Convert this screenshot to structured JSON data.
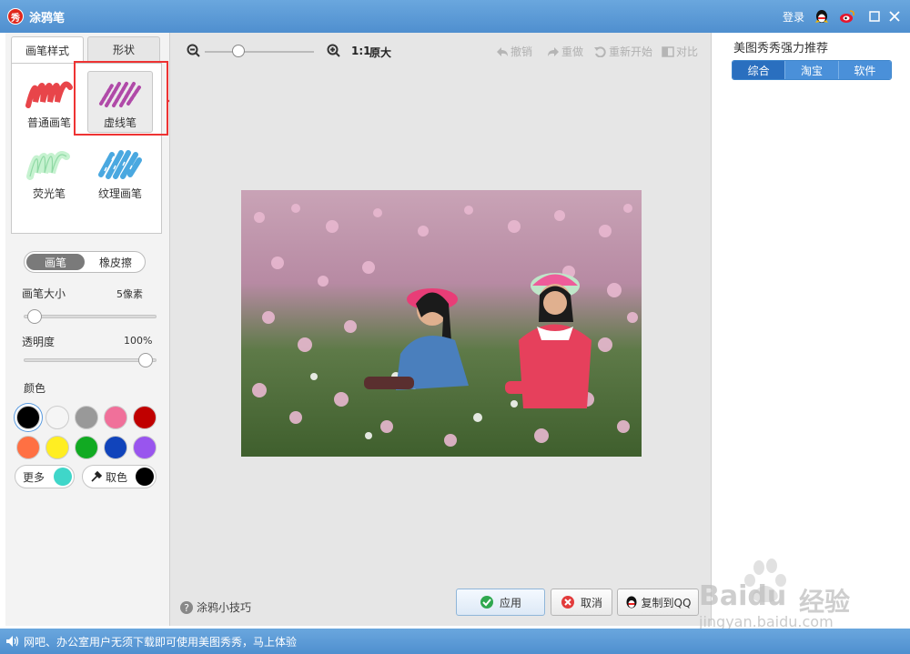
{
  "window": {
    "title": "涂鸦笔",
    "app_icon_text": "秀",
    "login": "登录"
  },
  "left": {
    "tabs": [
      "画笔样式",
      "形状"
    ],
    "brushes": [
      {
        "label": "普通画笔",
        "color": "#e8454a"
      },
      {
        "label": "虚线笔",
        "color": "#b04aa8"
      },
      {
        "label": "荧光笔",
        "color": "#9fe6b0"
      },
      {
        "label": "纹理画笔",
        "color": "#4aa8e0"
      }
    ],
    "mode": {
      "brush": "画笔",
      "eraser": "橡皮擦"
    },
    "size": {
      "label": "画笔大小",
      "value": "5像素"
    },
    "opacity": {
      "label": "透明度",
      "value": "100%"
    },
    "color_label": "颜色",
    "swatches": [
      "#000000",
      "#f5f5f5",
      "#999999",
      "#f0709a",
      "#c00000",
      "#ff7043",
      "#ffee22",
      "#11aa22",
      "#1144bb",
      "#9955ee"
    ],
    "more": {
      "label": "更多",
      "color": "#3fd6c9"
    },
    "picker": {
      "label": "取色",
      "color": "#000000"
    }
  },
  "toolbar": {
    "ratio": "1:1",
    "original": "原大",
    "undo": "撤销",
    "redo": "重做",
    "restart": "重新开始",
    "compare": "对比"
  },
  "bottom": {
    "tips": "涂鸦小技巧",
    "apply": "应用",
    "cancel": "取消",
    "copy_qq": "复制到QQ"
  },
  "right": {
    "title": "美图秀秀强力推荐",
    "tabs": [
      "综合",
      "淘宝",
      "软件"
    ]
  },
  "status": {
    "text": "网吧、办公室用户无须下载即可使用美图秀秀，马上体验"
  },
  "watermark": {
    "brand": "Baidu",
    "brand_cn": "经验",
    "url": "jingyan.baidu.com"
  }
}
